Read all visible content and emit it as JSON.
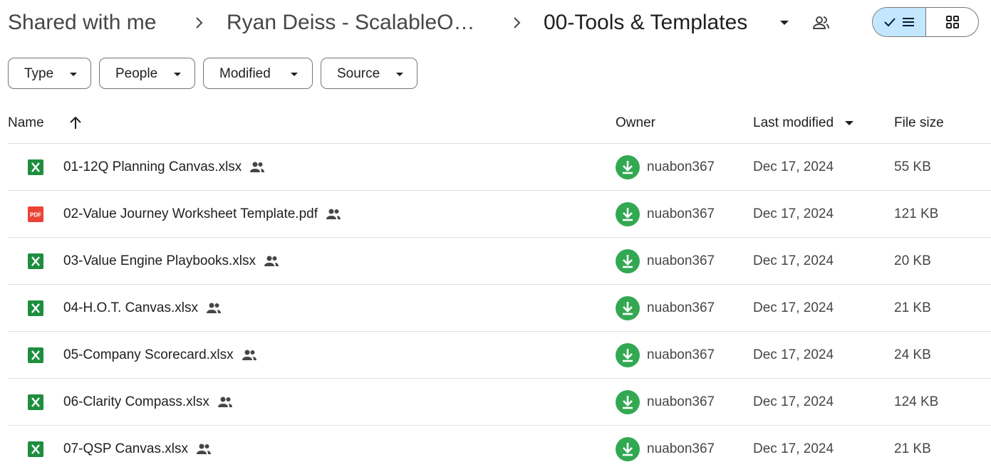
{
  "breadcrumb": {
    "root": "Shared with me",
    "parent": "Ryan Deiss - ScalableO…",
    "current": "00-Tools & Templates"
  },
  "filters": [
    {
      "label": "Type"
    },
    {
      "label": "People"
    },
    {
      "label": "Modified"
    },
    {
      "label": "Source"
    }
  ],
  "columns": {
    "name": "Name",
    "owner": "Owner",
    "last_modified": "Last modified",
    "file_size": "File size"
  },
  "icons": {
    "sheet_color": "#1e8e3e",
    "pdf_color": "#ea4335",
    "avatar_color": "#33a852",
    "toggle_active_color": "#c2e7ff"
  },
  "files": [
    {
      "name": "01-12Q Planning Canvas.xlsx",
      "type": "sheet",
      "owner": "nuabon367",
      "modified": "Dec 17, 2024",
      "size": "55 KB"
    },
    {
      "name": "02-Value Journey Worksheet Template.pdf",
      "type": "pdf",
      "owner": "nuabon367",
      "modified": "Dec 17, 2024",
      "size": "121 KB"
    },
    {
      "name": "03-Value Engine Playbooks.xlsx",
      "type": "sheet",
      "owner": "nuabon367",
      "modified": "Dec 17, 2024",
      "size": "20 KB"
    },
    {
      "name": "04-H.O.T. Canvas.xlsx",
      "type": "sheet",
      "owner": "nuabon367",
      "modified": "Dec 17, 2024",
      "size": "21 KB"
    },
    {
      "name": "05-Company Scorecard.xlsx",
      "type": "sheet",
      "owner": "nuabon367",
      "modified": "Dec 17, 2024",
      "size": "24 KB"
    },
    {
      "name": "06-Clarity Compass.xlsx",
      "type": "sheet",
      "owner": "nuabon367",
      "modified": "Dec 17, 2024",
      "size": "124 KB"
    },
    {
      "name": "07-QSP Canvas.xlsx",
      "type": "sheet",
      "owner": "nuabon367",
      "modified": "Dec 17, 2024",
      "size": "21 KB"
    }
  ]
}
